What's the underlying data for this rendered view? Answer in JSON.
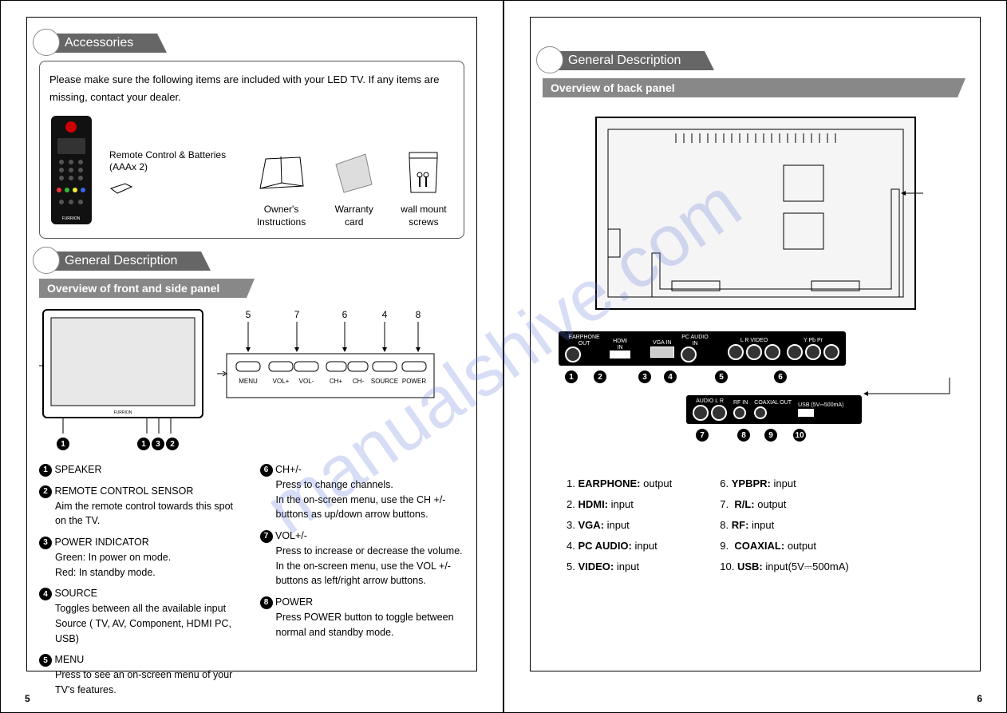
{
  "watermark": "manualshive.com",
  "pageLeft": {
    "pageNumber": "5",
    "accessories": {
      "header": "Accessories",
      "intro": "Please make sure the following items are included with your LED TV. If any items are missing, contact your dealer.",
      "items": {
        "remote": "Remote Control & Batteries (AAAx 2)",
        "owners": "Owner's Instructions",
        "warranty": "Warranty card",
        "screws": "wall mount screws"
      }
    },
    "general": {
      "header": "General Description",
      "subheader": "Overview of front and side panel",
      "buttonNumbers": [
        "5",
        "7",
        "6",
        "4",
        "8"
      ],
      "buttonLabels": [
        "MENU",
        "VOL+",
        "VOL-",
        "CH+",
        "CH-",
        "SOURCE",
        "POWER"
      ],
      "frontMarks": [
        "1",
        "1",
        "3",
        "2"
      ],
      "listLeft": [
        {
          "n": "1",
          "title": "SPEAKER",
          "desc": ""
        },
        {
          "n": "2",
          "title": "REMOTE CONTROL SENSOR",
          "desc": "Aim the remote control towards this spot on the TV."
        },
        {
          "n": "3",
          "title": "POWER INDICATOR",
          "desc": "Green: In power on mode.\nRed: In standby mode."
        },
        {
          "n": "4",
          "title": "SOURCE",
          "desc": "Toggles between all the available input Source ( TV, AV, Component, HDMI PC, USB)"
        },
        {
          "n": "5",
          "title": "MENU",
          "desc": "Press to see an on-screen menu of your TV's features."
        }
      ],
      "listRight": [
        {
          "n": "6",
          "title": "CH+/-",
          "desc": "Press to change channels.\nIn the on-screen menu, use the CH +/- buttons as up/down arrow buttons."
        },
        {
          "n": "7",
          "title": "VOL+/-",
          "desc": "Press to increase or decrease the volume. In the on-screen menu, use the VOL +/- buttons as left/right arrow buttons."
        },
        {
          "n": "8",
          "title": "POWER",
          "desc": "Press POWER button to toggle between normal and standby mode."
        }
      ]
    }
  },
  "pageRight": {
    "pageNumber": "6",
    "general": {
      "header": "General Description",
      "subheader": "Overview of back panel",
      "strip1Labels": [
        "EARPHONE OUT",
        "HDMI IN",
        "VGA IN",
        "PC AUDIO IN",
        "L R VIDEO",
        "Y Pb Pr"
      ],
      "strip1Numbers": [
        "1",
        "2",
        "3",
        "4",
        "5",
        "6"
      ],
      "strip2Labels": [
        "AUDIO L R",
        "RF IN",
        "COAXIAL OUT",
        "USB (5V⎓500mA)"
      ],
      "strip2Numbers": [
        "7",
        "8",
        "9",
        "10"
      ],
      "portsLeft": [
        {
          "n": "1.",
          "name": "EARPHONE:",
          "dir": "output"
        },
        {
          "n": "2.",
          "name": "HDMI:",
          "dir": "input"
        },
        {
          "n": "3.",
          "name": "VGA:",
          "dir": "input"
        },
        {
          "n": "4.",
          "name": "PC AUDIO:",
          "dir": "input"
        },
        {
          "n": "5.",
          "name": "VIDEO:",
          "dir": "input"
        }
      ],
      "portsRight": [
        {
          "n": "6.",
          "name": "YPBPR:",
          "dir": "input"
        },
        {
          "n": "7.",
          "name": "R/L:",
          "dir": "output"
        },
        {
          "n": "8.",
          "name": "RF:",
          "dir": "input"
        },
        {
          "n": "9.",
          "name": "COAXIAL:",
          "dir": "output"
        },
        {
          "n": "10.",
          "name": "USB:",
          "dir": "input(5V⎓500mA)"
        }
      ]
    }
  }
}
